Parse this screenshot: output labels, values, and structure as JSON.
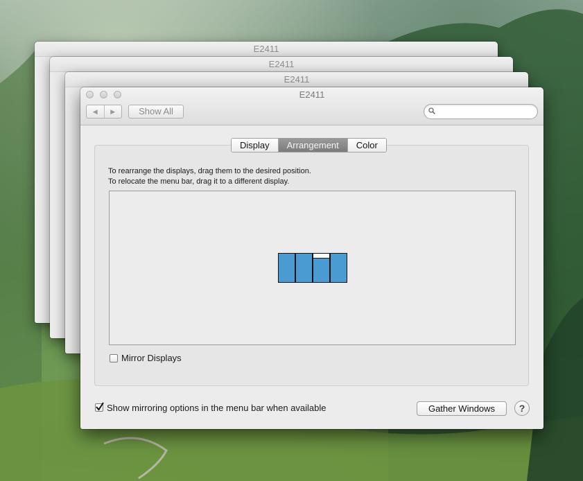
{
  "background_windows": [
    {
      "title": "E2411"
    },
    {
      "title": "E2411"
    },
    {
      "title": "E2411"
    }
  ],
  "window": {
    "title": "E2411",
    "toolbar": {
      "back_icon": "◀",
      "forward_icon": "▶",
      "show_all_label": "Show All",
      "search_placeholder": "",
      "search_value": ""
    },
    "tabs": [
      {
        "label": "Display",
        "active": false
      },
      {
        "label": "Arrangement",
        "active": true
      },
      {
        "label": "Color",
        "active": false
      }
    ],
    "instructions": {
      "line1": "To rearrange the displays, drag them to the desired position.",
      "line2": "To relocate the menu bar, drag it to a different display."
    },
    "displays": [
      {
        "id": 1,
        "has_menu_bar": false
      },
      {
        "id": 2,
        "has_menu_bar": false
      },
      {
        "id": 3,
        "has_menu_bar": true
      },
      {
        "id": 4,
        "has_menu_bar": false
      }
    ],
    "mirror_displays": {
      "label": "Mirror Displays",
      "checked": false
    },
    "show_mirroring": {
      "label": "Show mirroring options in the menu bar when available",
      "checked": true
    },
    "gather_windows_label": "Gather Windows",
    "help_label": "?"
  },
  "colors": {
    "display_fill": "#4a9bd1",
    "active_tab": "#8a8a8a"
  }
}
